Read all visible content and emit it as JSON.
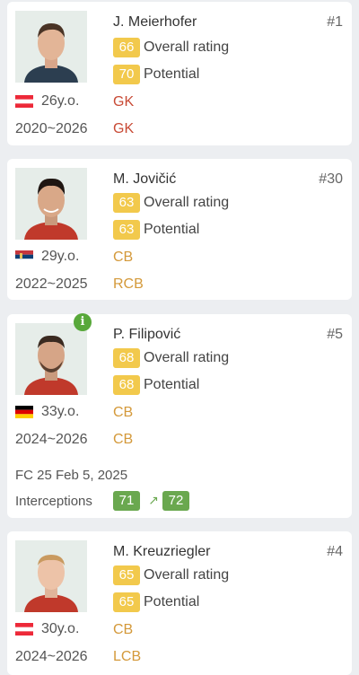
{
  "players": [
    {
      "photo_icon": "player-photo",
      "name": "J. Meierhofer",
      "number": "#1",
      "overall": "66",
      "overall_label": "Overall rating",
      "potential": "70",
      "potential_label": "Potential",
      "flag_icon": "austria-flag-icon",
      "age": "26y.o.",
      "contract": "2020~2026",
      "position": "GK",
      "role": "GK",
      "position_color": "#c84a35"
    },
    {
      "photo_icon": "player-photo",
      "name": "M. Jovičić",
      "number": "#30",
      "overall": "63",
      "overall_label": "Overall rating",
      "potential": "63",
      "potential_label": "Potential",
      "flag_icon": "serbia-flag-icon",
      "age": "29y.o.",
      "contract": "2022~2025",
      "position": "CB",
      "role": "RCB",
      "position_color": "#d4993a"
    },
    {
      "photo_icon": "player-photo",
      "name": "P. Filipović",
      "number": "#5",
      "overall": "68",
      "overall_label": "Overall rating",
      "potential": "68",
      "potential_label": "Potential",
      "flag_icon": "germany-flag-icon",
      "age": "33y.o.",
      "contract": "2024~2026",
      "position": "CB",
      "role": "CB",
      "position_color": "#d4993a",
      "info_icon": "info-icon",
      "update_note": "FC 25 Feb 5, 2025",
      "stat_name": "Interceptions",
      "stat_from": "71",
      "stat_to": "72",
      "stat_arrow_icon": "arrow-up-right-icon"
    },
    {
      "photo_icon": "player-photo",
      "name": "M. Kreuzriegler",
      "number": "#4",
      "overall": "65",
      "overall_label": "Overall rating",
      "potential": "65",
      "potential_label": "Potential",
      "flag_icon": "austria-flag-icon",
      "age": "30y.o.",
      "contract": "2024~2026",
      "position": "CB",
      "role": "LCB",
      "position_color": "#d4993a"
    }
  ],
  "colors": {
    "rating_badge": "#f2c94c",
    "stat_badge": "#6aa84f",
    "gk": "#c84a35",
    "def": "#d4993a"
  }
}
